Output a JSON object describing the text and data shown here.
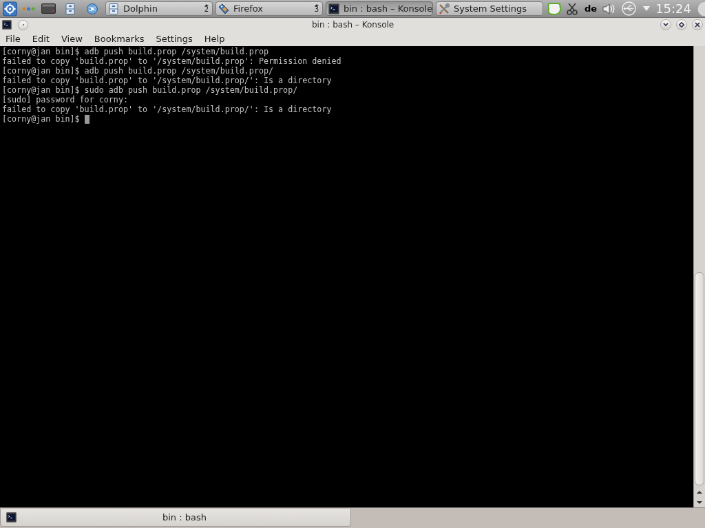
{
  "taskbar": {
    "tasks": [
      {
        "kind": "files",
        "label": "Dolphin",
        "count": "2",
        "selected": false
      },
      {
        "kind": "browser",
        "label": "Firefox",
        "count": "3",
        "selected": false
      },
      {
        "kind": "terminal",
        "label": "bin : bash – Konsole",
        "selected": true
      },
      {
        "kind": "settings",
        "label": "System Settings",
        "selected": false
      }
    ],
    "keyboard_layout": "de",
    "clock": "15:24"
  },
  "window": {
    "title": "bin : bash – Konsole"
  },
  "menu": [
    "File",
    "Edit",
    "View",
    "Bookmarks",
    "Settings",
    "Help"
  ],
  "terminal": {
    "lines": [
      "[corny@jan bin]$ adb push build.prop /system/build.prop",
      "failed to copy 'build.prop' to '/system/build.prop': Permission denied",
      "[corny@jan bin]$ adb push build.prop /system/build.prop/",
      "failed to copy 'build.prop' to '/system/build.prop/': Is a directory",
      "[corny@jan bin]$ sudo adb push build.prop /system/build.prop/",
      "[sudo] password for corny:",
      "failed to copy 'build.prop' to '/system/build.prop/': Is a directory",
      "[corny@jan bin]$"
    ],
    "cursor": true
  },
  "tabs": [
    {
      "label": "bin : bash",
      "selected": true
    }
  ]
}
